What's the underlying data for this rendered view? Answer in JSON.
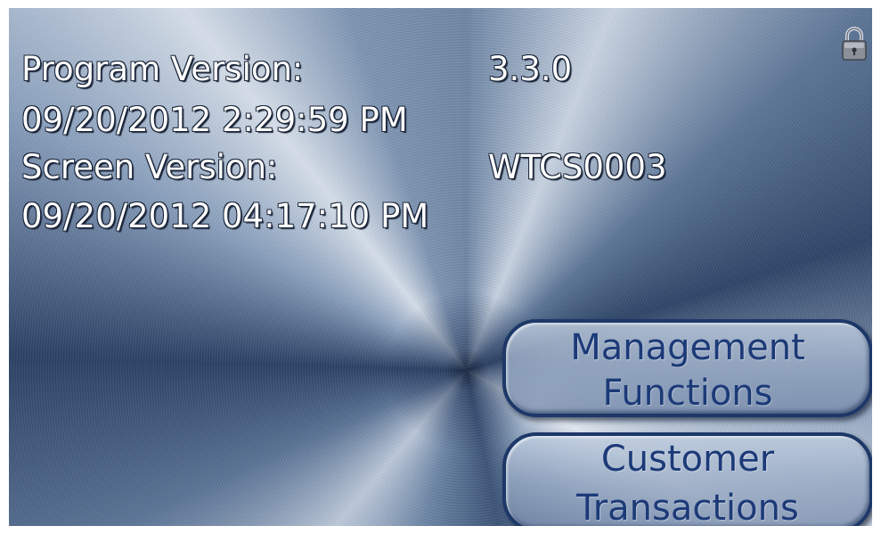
{
  "info": {
    "program_version_label": "Program Version:",
    "program_version_value": "3.3.0",
    "program_version_date": "09/20/2012 2:29:59 PM",
    "screen_version_label": "Screen Version:",
    "screen_version_value": "WTCS0003",
    "screen_version_date": "09/20/2012 04:17:10 PM"
  },
  "buttons": {
    "management": {
      "line1": "Management",
      "line2": "Functions"
    },
    "customer": {
      "line1": "Customer",
      "line2": "Transactions"
    }
  },
  "icons": {
    "lock": "lock-icon"
  },
  "colors": {
    "button_text": "#1c3a78",
    "button_border": "#1d3868",
    "info_text": "#ffffff"
  }
}
